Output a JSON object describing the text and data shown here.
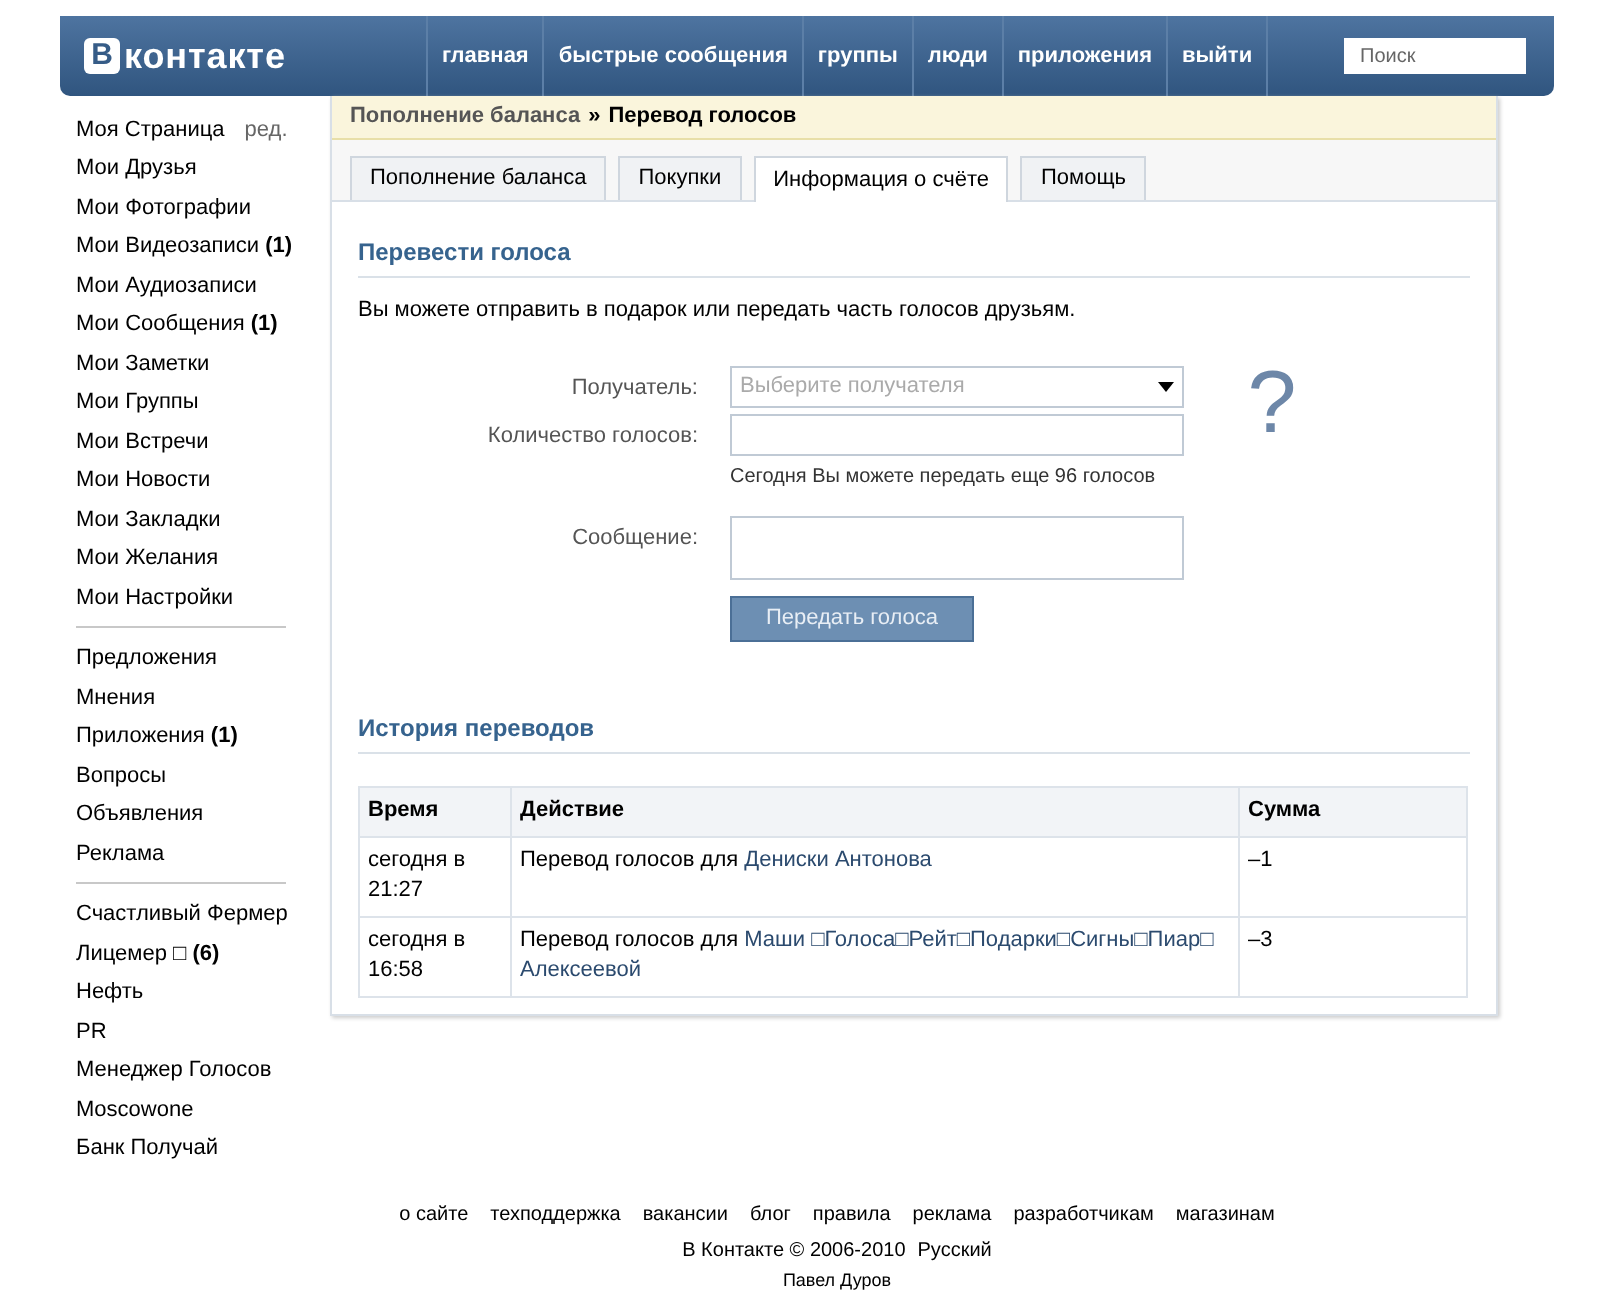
{
  "header": {
    "logo_badge": "В",
    "logo_text": "контакте",
    "nav": [
      "главная",
      "быстрые сообщения",
      "группы",
      "люди",
      "приложения",
      "выйти"
    ],
    "search": {
      "placeholder": "Поиск"
    }
  },
  "sidebar": {
    "edit_link": "ред.",
    "groups": [
      [
        "Моя Страница",
        "Мои Друзья",
        "Мои Фотографии",
        "Мои Видеозаписи **(1)**",
        "Мои Аудиозаписи",
        "Мои Сообщения **(1)**",
        "Мои Заметки",
        "Мои Группы",
        "Мои Встречи",
        "Мои Новости",
        "Мои Закладки",
        "Мои Желания",
        "Мои Настройки"
      ],
      [
        "Предложения",
        "Мнения",
        "Приложения **(1)**",
        "Вопросы",
        "Объявления",
        "Реклама"
      ],
      [
        "Счастливый Фермер",
        "Лицемер □ **(6)**",
        "Нефть",
        "PR",
        "Менеджер Голосов",
        "Moscowone",
        "Банк Получай"
      ]
    ]
  },
  "breadcrumb": {
    "parent": "Пополнение баланса",
    "separator": "»",
    "current": "Перевод голосов"
  },
  "tabs": [
    {
      "label": "Пополнение баланса",
      "selected": false
    },
    {
      "label": "Покупки",
      "selected": false
    },
    {
      "label": "Информация о счёте",
      "selected": true
    },
    {
      "label": "Помощь",
      "selected": false
    }
  ],
  "transfer": {
    "title": "Перевести голоса",
    "description": "Вы можете отправить в подарок или передать часть голосов друзьям.",
    "fields": [
      {
        "label": "Получатель:",
        "kind": "select",
        "placeholder": "Выберите получателя"
      },
      {
        "label": "Количество голосов:",
        "kind": "input",
        "hint": "Сегодня Вы можете передать еще 96 голосов"
      },
      {
        "label": "Сообщение:",
        "kind": "textarea"
      }
    ],
    "avatar_placeholder": "?",
    "button": "Передать голоса"
  },
  "history": {
    "title": "История переводов",
    "columns": [
      "Время",
      "Действие",
      "Сумма"
    ],
    "rows": [
      {
        "time": "сегодня в 21:27",
        "action": "Перевод голосов для",
        "recipient": "Дениски Антонова",
        "amount": "–1"
      },
      {
        "time": "сегодня в 16:58",
        "action": "Перевод голосов для",
        "recipient": "Маши □Голоса□Рейт□Подарки□Сигны□Пиар□ Алексеевой",
        "amount": "–3"
      }
    ]
  },
  "footer": {
    "links": [
      "о сайте",
      "техподдержка",
      "вакансии",
      "блог",
      "правила",
      "реклама",
      "разработчикам",
      "магазинам"
    ],
    "copyright": "В Контакте © 2006-2010",
    "language": "Русский",
    "author": "Павел Дуров"
  }
}
